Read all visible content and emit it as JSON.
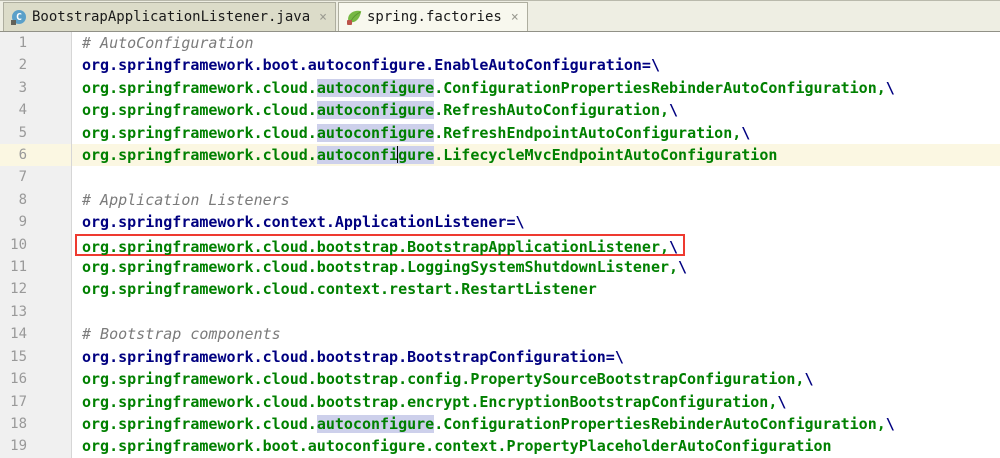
{
  "tabs": [
    {
      "label": "BootstrapApplicationListener.java",
      "icon": "java-class-icon",
      "class_letter": "C",
      "close_glyph": "×",
      "active": false
    },
    {
      "label": "spring.factories",
      "icon": "spring-leaf-icon",
      "close_glyph": "×",
      "active": true
    }
  ],
  "colors": {
    "property_key": "#000080",
    "property_value": "#008000",
    "comment": "#7b7b7b",
    "identifier_highlight_bg": "#cdd0eb",
    "current_line_bg": "#fbf7e2",
    "annotation_box": "#ee3a30",
    "spring_green": "#77b843",
    "class_icon_blue": "#5ba0c9"
  },
  "editor": {
    "lines": [
      {
        "num": "1",
        "current": false,
        "boxed": false,
        "segments": [
          [
            "comment",
            "# AutoConfiguration"
          ]
        ]
      },
      {
        "num": "2",
        "current": false,
        "boxed": false,
        "segments": [
          [
            "key",
            "org.springframework.boot.autoconfigure.EnableAutoConfiguration=\\"
          ]
        ]
      },
      {
        "num": "3",
        "current": false,
        "boxed": false,
        "segments": [
          [
            "value",
            "org.springframework.cloud."
          ],
          [
            "hl",
            "autoconfigure"
          ],
          [
            "value",
            ".ConfigurationPropertiesRebinderAutoConfiguration,"
          ],
          [
            "esc",
            "\\"
          ]
        ]
      },
      {
        "num": "4",
        "current": false,
        "boxed": false,
        "segments": [
          [
            "value",
            "org.springframework.cloud."
          ],
          [
            "hl",
            "autoconfigure"
          ],
          [
            "value",
            ".RefreshAutoConfiguration,"
          ],
          [
            "esc",
            "\\"
          ]
        ]
      },
      {
        "num": "5",
        "current": false,
        "boxed": false,
        "segments": [
          [
            "value",
            "org.springframework.cloud."
          ],
          [
            "hl",
            "autoconfigure"
          ],
          [
            "value",
            ".RefreshEndpointAutoConfiguration,"
          ],
          [
            "esc",
            "\\"
          ]
        ]
      },
      {
        "num": "6",
        "current": true,
        "boxed": false,
        "segments": [
          [
            "value",
            "org.springframework.cloud."
          ],
          [
            "hl",
            "autoconfi"
          ],
          [
            "caret",
            ""
          ],
          [
            "hl",
            "gure"
          ],
          [
            "value",
            ".LifecycleMvcEndpointAutoConfiguration"
          ]
        ]
      },
      {
        "num": "7",
        "current": false,
        "boxed": false,
        "segments": []
      },
      {
        "num": "8",
        "current": false,
        "boxed": false,
        "segments": [
          [
            "comment",
            "# Application Listeners"
          ]
        ]
      },
      {
        "num": "9",
        "current": false,
        "boxed": false,
        "segments": [
          [
            "key",
            "org.springframework.context.ApplicationListener=\\"
          ]
        ]
      },
      {
        "num": "10",
        "current": false,
        "boxed": true,
        "segments": [
          [
            "value",
            "org.springframework.cloud.bootstrap.BootstrapApplicationListener,"
          ],
          [
            "esc",
            "\\"
          ]
        ]
      },
      {
        "num": "11",
        "current": false,
        "boxed": false,
        "segments": [
          [
            "value",
            "org.springframework.cloud.bootstrap.LoggingSystemShutdownListener,"
          ],
          [
            "esc",
            "\\"
          ]
        ]
      },
      {
        "num": "12",
        "current": false,
        "boxed": false,
        "segments": [
          [
            "value",
            "org.springframework.cloud.context.restart.RestartListener"
          ]
        ]
      },
      {
        "num": "13",
        "current": false,
        "boxed": false,
        "segments": []
      },
      {
        "num": "14",
        "current": false,
        "boxed": false,
        "segments": [
          [
            "comment",
            "# Bootstrap components"
          ]
        ]
      },
      {
        "num": "15",
        "current": false,
        "boxed": false,
        "segments": [
          [
            "key",
            "org.springframework.cloud.bootstrap.BootstrapConfiguration=\\"
          ]
        ]
      },
      {
        "num": "16",
        "current": false,
        "boxed": false,
        "segments": [
          [
            "value",
            "org.springframework.cloud.bootstrap.config.PropertySourceBootstrapConfiguration,"
          ],
          [
            "esc",
            "\\"
          ]
        ]
      },
      {
        "num": "17",
        "current": false,
        "boxed": false,
        "segments": [
          [
            "value",
            "org.springframework.cloud.bootstrap.encrypt.EncryptionBootstrapConfiguration,"
          ],
          [
            "esc",
            "\\"
          ]
        ]
      },
      {
        "num": "18",
        "current": false,
        "boxed": false,
        "segments": [
          [
            "value",
            "org.springframework.cloud."
          ],
          [
            "hl",
            "autoconfigure"
          ],
          [
            "value",
            ".ConfigurationPropertiesRebinderAutoConfiguration,"
          ],
          [
            "esc",
            "\\"
          ]
        ]
      },
      {
        "num": "19",
        "current": false,
        "boxed": false,
        "segments": [
          [
            "value",
            "org.springframework.boot.autoconfigure.context.PropertyPlaceholderAutoConfiguration"
          ]
        ]
      }
    ]
  }
}
